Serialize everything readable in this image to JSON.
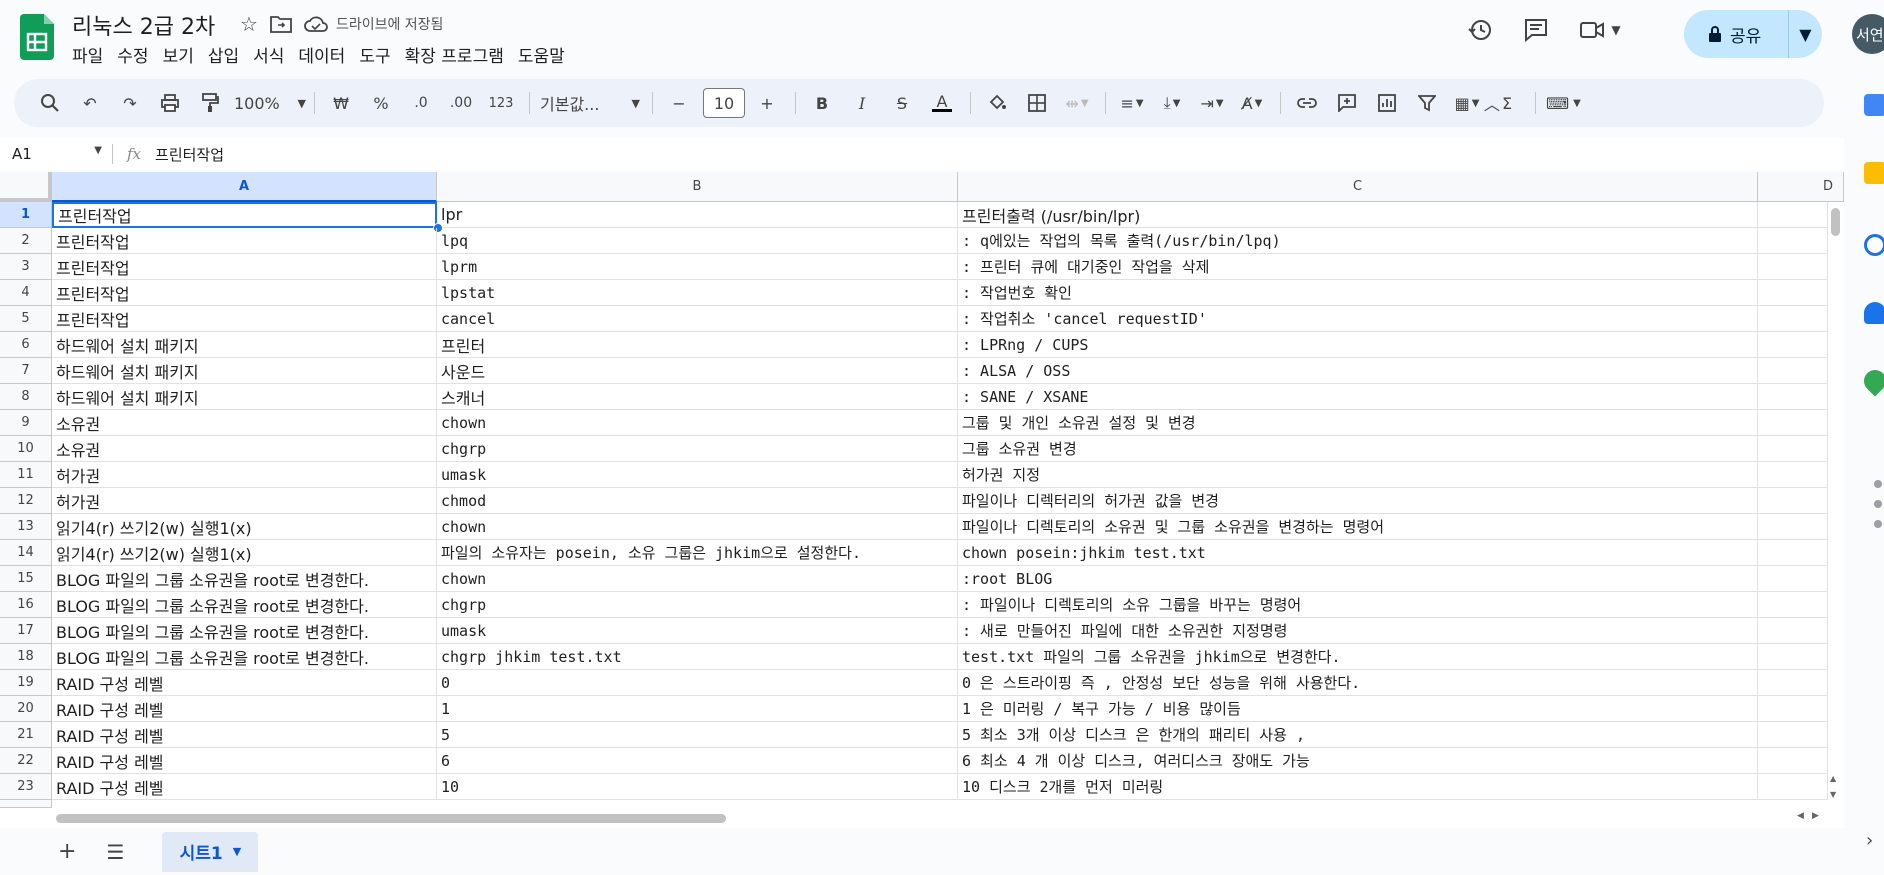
{
  "doc": {
    "title": "리눅스 2급 2차",
    "save_status": "드라이브에 저장됨"
  },
  "menu": [
    "파일",
    "수정",
    "보기",
    "삽입",
    "서식",
    "데이터",
    "도구",
    "확장 프로그램",
    "도움말"
  ],
  "share": {
    "label": "공유"
  },
  "user": {
    "avatar_text": "서연"
  },
  "toolbar": {
    "zoom": "100%",
    "currency": "₩",
    "percent": "%",
    "dec_decrease": ".0",
    "dec_increase": ".00",
    "number_format": "123",
    "font": "기본값...",
    "font_size": "10"
  },
  "formula_bar": {
    "cell_ref": "A1",
    "fx": "fx",
    "content": "프린터작업"
  },
  "columns": [
    "A",
    "B",
    "C",
    "D"
  ],
  "rows": [
    {
      "n": "1",
      "a": "프린터작업",
      "b": "lpr",
      "c": "프린터출력 (/usr/bin/lpr)"
    },
    {
      "n": "2",
      "a": "프린터작업",
      "b": "lpq",
      "c": ": q에있는 작업의 목록 출력(/usr/bin/lpq)"
    },
    {
      "n": "3",
      "a": "프린터작업",
      "b": "lprm",
      "c": ": 프린터 큐에 대기중인 작업을 삭제"
    },
    {
      "n": "4",
      "a": "프린터작업",
      "b": "lpstat",
      "c": ": 작업번호 확인"
    },
    {
      "n": "5",
      "a": "프린터작업",
      "b": "cancel",
      "c": ": 작업취소 'cancel requestID'"
    },
    {
      "n": "6",
      "a": "하드웨어 설치 패키지",
      "b": "프린터",
      "c": ": LPRng / CUPS"
    },
    {
      "n": "7",
      "a": "하드웨어 설치 패키지",
      "b": "사운드",
      "c": ": ALSA / OSS"
    },
    {
      "n": "8",
      "a": "하드웨어 설치 패키지",
      "b": "스캐너",
      "c": ": SANE / XSANE"
    },
    {
      "n": "9",
      "a": "소유권",
      "b": "chown",
      "c": "그룹 및 개인 소유권 설정 및 변경"
    },
    {
      "n": "10",
      "a": "소유권",
      "b": "chgrp",
      "c": "그룹 소유권 변경"
    },
    {
      "n": "11",
      "a": "허가권",
      "b": "umask",
      "c": "허가권 지정"
    },
    {
      "n": "12",
      "a": "허가권",
      "b": "chmod",
      "c": "파일이나 디렉터리의 허가권 값을 변경"
    },
    {
      "n": "13",
      "a": "읽기4(r) 쓰기2(w) 실행1(x)",
      "b": "chown",
      "c": "파일이나 디렉토리의 소유권 및 그룹 소유권을 변경하는 명령어"
    },
    {
      "n": "14",
      "a": "읽기4(r) 쓰기2(w) 실행1(x)",
      "b": "파일의 소유자는 posein, 소유 그룹은 jhkim으로 설정한다.",
      "c": "chown posein:jhkim test.txt"
    },
    {
      "n": "15",
      "a": "BLOG 파일의 그룹 소유권을 root로 변경한다.",
      "b": "chown",
      "c": ":root BLOG"
    },
    {
      "n": "16",
      "a": "BLOG 파일의 그룹 소유권을 root로 변경한다.",
      "b": "chgrp",
      "c": ": 파일이나 디렉토리의 소유 그룹을 바꾸는 명령어"
    },
    {
      "n": "17",
      "a": "BLOG 파일의 그룹 소유권을 root로 변경한다.",
      "b": "umask",
      "c": ": 새로 만들어진 파일에 대한 소유권한 지정명령"
    },
    {
      "n": "18",
      "a": "BLOG 파일의 그룹 소유권을 root로 변경한다.",
      "b": "chgrp jhkim test.txt",
      "c": "test.txt 파일의 그룹 소유권을 jhkim으로 변경한다."
    },
    {
      "n": "19",
      "a": "RAID 구성 레벨",
      "b": "0",
      "c": "0 은 스트라이핑 즉 , 안정성 보단 성능을 위해 사용한다."
    },
    {
      "n": "20",
      "a": "RAID 구성 레벨",
      "b": "1",
      "c": "1 은 미러링 / 복구 가능 / 비용 많이듬"
    },
    {
      "n": "21",
      "a": "RAID 구성 레벨",
      "b": "5",
      "c": "5 최소 3개 이상 디스크 은 한개의 패리티 사용 ,"
    },
    {
      "n": "22",
      "a": "RAID 구성 레벨",
      "b": "6",
      "c": "6 최소 4 개 이상 디스크, 여러디스크 장애도 가능"
    },
    {
      "n": "23",
      "a": "RAID 구성 레벨",
      "b": "10",
      "c": "10 디스크 2개를 먼저 미러링"
    }
  ],
  "sheets": [
    {
      "label": "시트1"
    }
  ],
  "colors": {
    "accent": "#1a73e8",
    "share_bg": "#c2e7ff",
    "sheets_green": "#0f9d58"
  }
}
